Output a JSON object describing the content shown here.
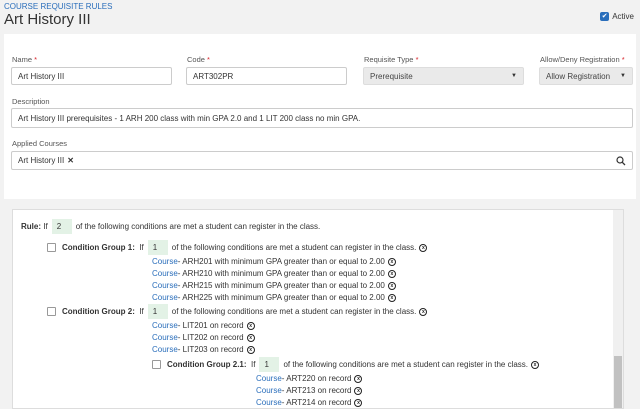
{
  "breadcrumb": "COURSE REQUISITE RULES",
  "page_title": "Art History III",
  "active_label": "Active",
  "form": {
    "name_label": "Name",
    "name_value": "Art History III",
    "code_label": "Code",
    "code_value": "ART302PR",
    "req_type_label": "Requisite Type",
    "req_type_value": "Prerequisite",
    "allow_label": "Allow/Deny Registration",
    "allow_value": "Allow Registration",
    "desc_label": "Description",
    "desc_value": "Art History III prerequisites - 1 ARH 200 class with min GPA 2.0 and 1 LIT 200 class no min GPA.",
    "applied_label": "Applied Courses",
    "applied_chip": "Art History III"
  },
  "rules": {
    "rule_prefix": "Rule:",
    "if": "If",
    "rule_count": "2",
    "rule_suffix": "of the following conditions are met a student can register in the class.",
    "groups": [
      {
        "label": "Condition Group 1:",
        "count": "1",
        "items": [
          {
            "link": "Course",
            "text": " - ARH201 with minimum GPA greater than or equal to 2.00"
          },
          {
            "link": "Course",
            "text": " - ARH210 with minimum GPA greater than or equal to 2.00"
          },
          {
            "link": "Course",
            "text": " - ARH215 with minimum GPA greater than or equal to 2.00"
          },
          {
            "link": "Course",
            "text": " - ARH225 with minimum GPA greater than or equal to 2.00"
          }
        ]
      },
      {
        "label": "Condition Group 2:",
        "count": "1",
        "items": [
          {
            "link": "Course",
            "text": " - LIT201 on record"
          },
          {
            "link": "Course",
            "text": " - LIT202 on record"
          },
          {
            "link": "Course",
            "text": " - LIT203 on record"
          }
        ]
      },
      {
        "label": "Condition Group 2.1:",
        "count": "1",
        "items": [
          {
            "link": "Course",
            "text": " - ART220 on record"
          },
          {
            "link": "Course",
            "text": " - ART213 on record"
          },
          {
            "link": "Course",
            "text": " - ART214 on record"
          }
        ]
      }
    ]
  },
  "icons": {
    "info": "info-circle-icon",
    "remove": "close-icon",
    "search": "search-icon",
    "caret": "caret-down-icon"
  },
  "colors": {
    "accent": "#2a6ebb",
    "required": "#d8232a",
    "count_bg": "#e3f2e6"
  }
}
